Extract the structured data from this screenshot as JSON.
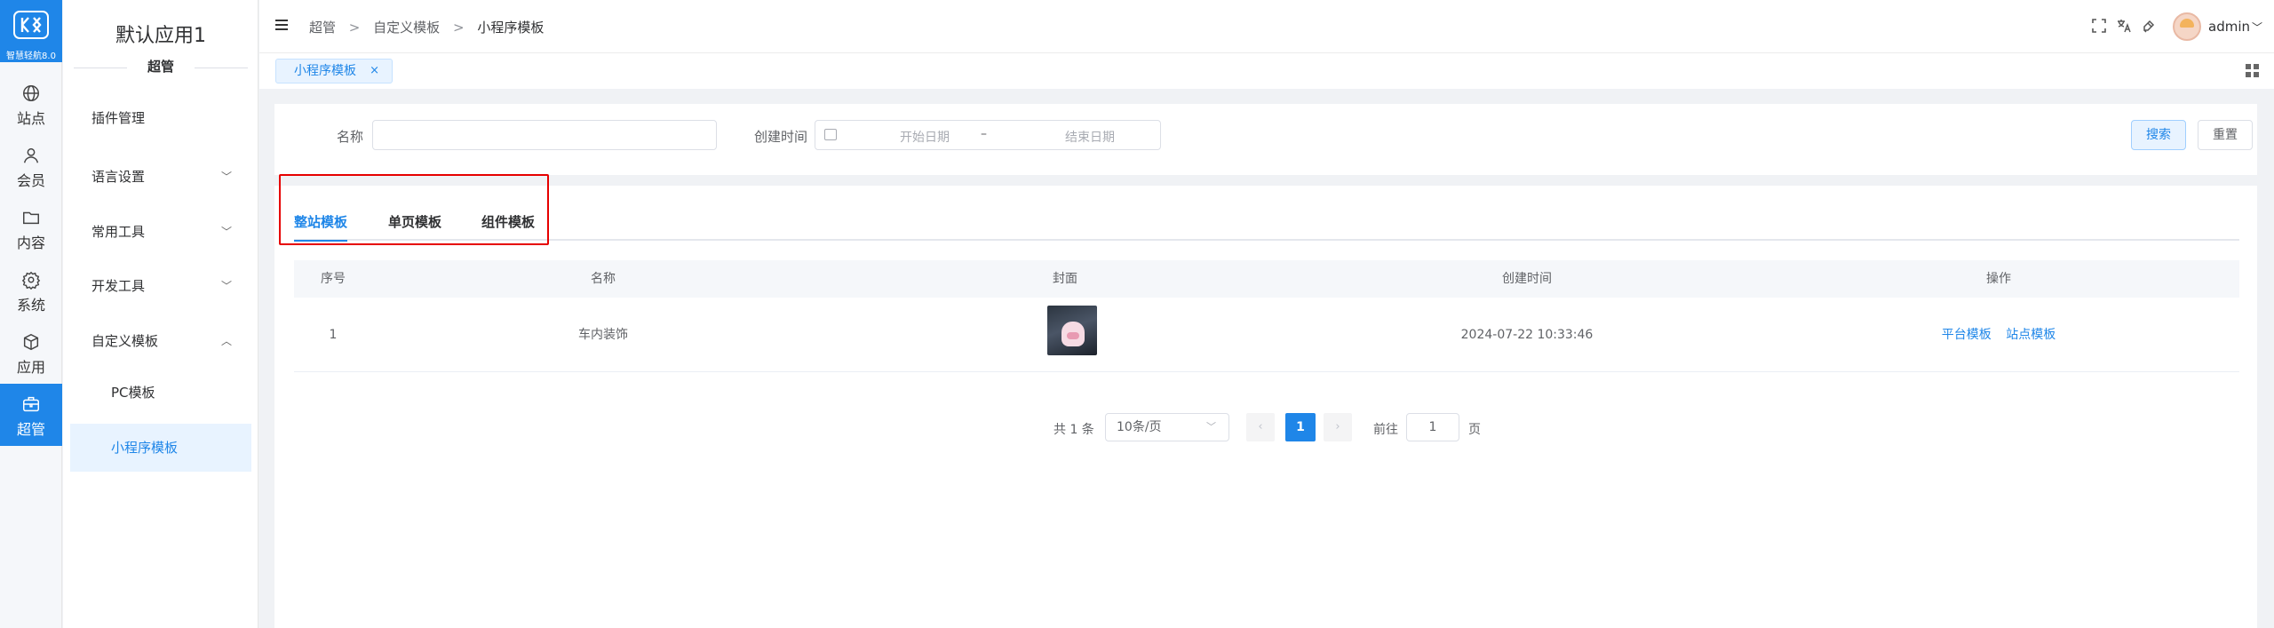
{
  "brand": {
    "version": "智慧轻航8.0"
  },
  "rail": [
    {
      "label": "站点",
      "icon": "globe-icon",
      "active": false
    },
    {
      "label": "会员",
      "icon": "user-icon",
      "active": false
    },
    {
      "label": "内容",
      "icon": "folder-icon",
      "active": false
    },
    {
      "label": "系统",
      "icon": "gear-icon",
      "active": false
    },
    {
      "label": "应用",
      "icon": "cube-icon",
      "active": false
    },
    {
      "label": "超管",
      "icon": "briefcase-icon",
      "active": true
    }
  ],
  "submenu": {
    "app_title": "默认应用1",
    "section": "超管",
    "items": [
      {
        "label": "插件管理",
        "chevron": ""
      },
      {
        "label": "语言设置",
        "chevron": "﹀"
      },
      {
        "label": "常用工具",
        "chevron": "﹀"
      },
      {
        "label": "开发工具",
        "chevron": "﹀"
      },
      {
        "label": "自定义模板",
        "chevron": "︿"
      },
      {
        "label": "PC模板",
        "chevron": ""
      },
      {
        "label": "小程序模板",
        "chevron": "",
        "selected": true
      }
    ]
  },
  "header": {
    "breadcrumbs": [
      "超管",
      "自定义模板",
      "小程序模板"
    ],
    "separator": ">",
    "username": "admin"
  },
  "tabbar": {
    "tab_label": "小程序模板",
    "close": "×"
  },
  "search": {
    "name_label": "名称",
    "name_value": "",
    "created_label": "创建时间",
    "start_placeholder": "开始日期",
    "range_sep": "–",
    "end_placeholder": "结束日期",
    "search_button": "搜索",
    "reset_button": "重置"
  },
  "type_tabs": [
    {
      "label": "整站模板",
      "active": true
    },
    {
      "label": "单页模板",
      "active": false
    },
    {
      "label": "组件模板",
      "active": false
    }
  ],
  "table": {
    "columns": [
      "序号",
      "名称",
      "封面",
      "创建时间",
      "操作"
    ],
    "rows": [
      {
        "index": "1",
        "name": "车内装饰",
        "created": "2024-07-22 10:33:46",
        "actions": [
          "平台模板",
          "站点模板"
        ]
      }
    ]
  },
  "pagination": {
    "total_text": "共 1 条",
    "page_size": "10条/页",
    "current_page": "1",
    "goto_label": "前往",
    "goto_value": "1",
    "page_suffix": "页"
  },
  "colors": {
    "primary": "#1f86e8",
    "highlight_box": "#e60000"
  }
}
